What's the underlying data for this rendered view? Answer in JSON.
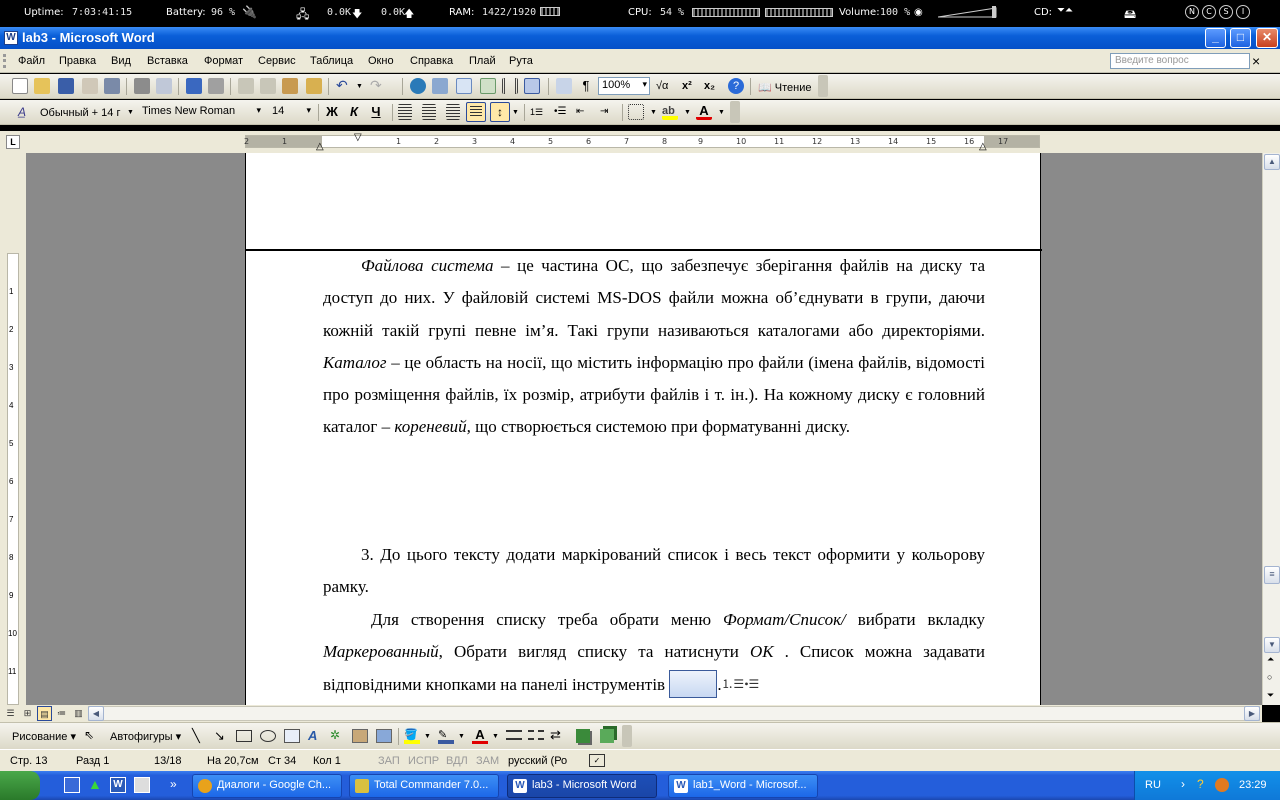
{
  "sysbar": {
    "uptime_label": "Uptime:",
    "uptime_value": "7:03:41:15",
    "battery_label": "Battery:",
    "battery_value": "96 %",
    "net_down": "0.0K",
    "net_up": "0.0K",
    "ram_label": "RAM:",
    "ram_value": "1422/1920",
    "cpu_label": "CPU:",
    "cpu_value": "54 %",
    "volume_label": "Volume:",
    "volume_value": "100 %",
    "cd_label": "CD:",
    "lock_keys": [
      "N",
      "C",
      "S",
      "I"
    ]
  },
  "window": {
    "title": "lab3 - Microsoft Word",
    "min": "_",
    "max": "□",
    "close": "✕"
  },
  "menu": {
    "items": [
      "Файл",
      "Правка",
      "Вид",
      "Вставка",
      "Формат",
      "Сервис",
      "Таблица",
      "Окно",
      "Справка",
      "Плай",
      "Рута"
    ],
    "help_placeholder": "Введите вопрос",
    "close_doc": "×"
  },
  "toolbar_standard": {
    "zoom": "100%",
    "reading_label": "Чтение"
  },
  "toolbar_format": {
    "style": "Обычный + 14 г",
    "font": "Times New Roman",
    "size": "14",
    "bold": "Ж",
    "italic": "К",
    "underline": "Ч"
  },
  "ruler": {
    "corner": "L",
    "ticks": [
      "2",
      "1",
      "1",
      "2",
      "3",
      "4",
      "5",
      "6",
      "7",
      "8",
      "9",
      "10",
      "11",
      "12",
      "13",
      "14",
      "15",
      "16",
      "17",
      "18"
    ],
    "vticks": [
      "1",
      "2",
      "3",
      "4",
      "5",
      "6",
      "7",
      "8",
      "9",
      "10",
      "11"
    ]
  },
  "document": {
    "para1": {
      "term": "Файлова система",
      "text1": " – це частина ОС, що забезпечує зберігання файлів на диску та доступ до них. У файловій системі MS-DOS файли можна об’єднувати в групи, даючи кожній такій групі певне ім’я. Такі групи називаються каталогами або директоріями. ",
      "term2": "Каталог",
      "text2": " – це область на носії, що містить інформацію про файли (імена файлів, відомості про розміщення файлів, їх розмір, атрибути файлів і т. ін.). На кожному диску є головний каталог – ",
      "term3": "кореневий,",
      "text3": " що створюється системою при форматуванні диску."
    },
    "para2": "3. До цього тексту додати маркірований список і весь текст оформити у кольорову рамку.",
    "para3": {
      "text1": "Для створення списку треба обрати меню ",
      "term1": "Формат/Список/",
      "text2": " вибрати вкладку ",
      "term2": "Маркерованный",
      "text3": ", Обрати вигляд списку та натиснути ",
      "term3": "ОК",
      "text4": " . Список можна задавати відповідними кнопками на панелі інструментів ",
      "tail": "."
    }
  },
  "drawing_toolbar": {
    "draw_label": "Рисование",
    "autoshapes_label": "Автофигуры"
  },
  "status": {
    "page": "Стр. 13",
    "section": "Разд 1",
    "pages": "13/18",
    "at": "На 20,7см",
    "line": "Ст 34",
    "col": "Кол 1",
    "rec": "ЗАП",
    "trk": "ИСПР",
    "ext": "ВДЛ",
    "ovr": "ЗАМ",
    "lang": "русский (Ро"
  },
  "taskbar": {
    "tasks": [
      {
        "label": "Диалоги - Google Ch...",
        "color": "#e8a21b"
      },
      {
        "label": "Total Commander 7.0...",
        "color": "#d8c040"
      },
      {
        "label": "lab3 - Microsoft Word",
        "color": "#2a5ab8"
      },
      {
        "label": "lab1_Word - Microsof...",
        "color": "#2a5ab8"
      }
    ],
    "lang": "RU",
    "clock": "23:29",
    "more": "»"
  },
  "colors": {
    "titlebar": "#0a5fd8",
    "taskbar": "#245edb",
    "tray": "#0f79d8",
    "chrome": "#ece9d8"
  }
}
